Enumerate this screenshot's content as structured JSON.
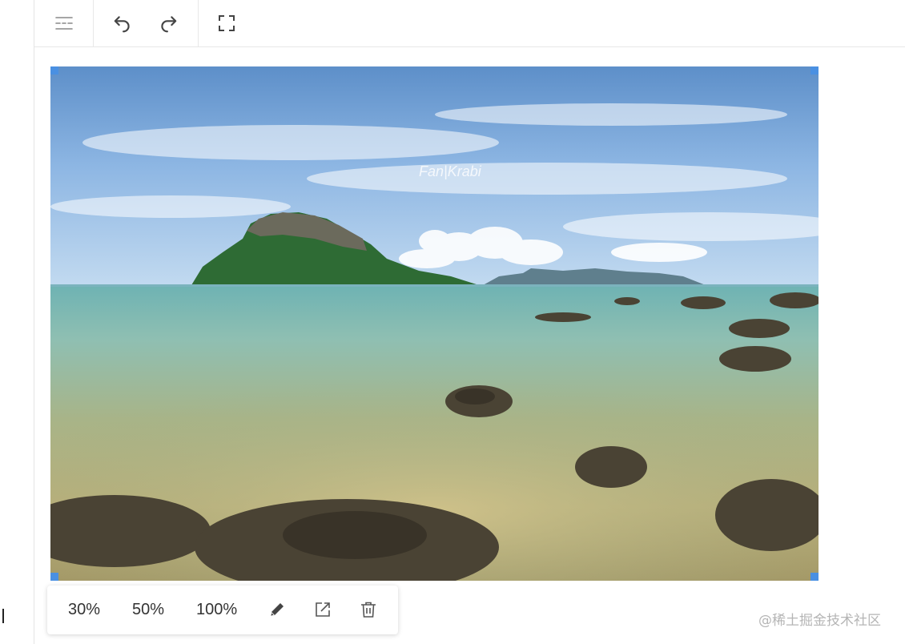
{
  "toolbar": {
    "icons": [
      "outline-toggle-icon",
      "undo-icon",
      "redo-icon",
      "fullscreen-icon"
    ]
  },
  "image": {
    "watermark_text": "Fan|Krabi"
  },
  "image_toolbar": {
    "size_30": "30%",
    "size_50": "50%",
    "size_100": "100%",
    "icons": [
      "pencil-icon",
      "open-external-icon",
      "trash-icon"
    ]
  },
  "watermark": "@稀土掘金技术社区",
  "colors": {
    "handle": "#4a90e2",
    "border": "#e8e8e8"
  }
}
